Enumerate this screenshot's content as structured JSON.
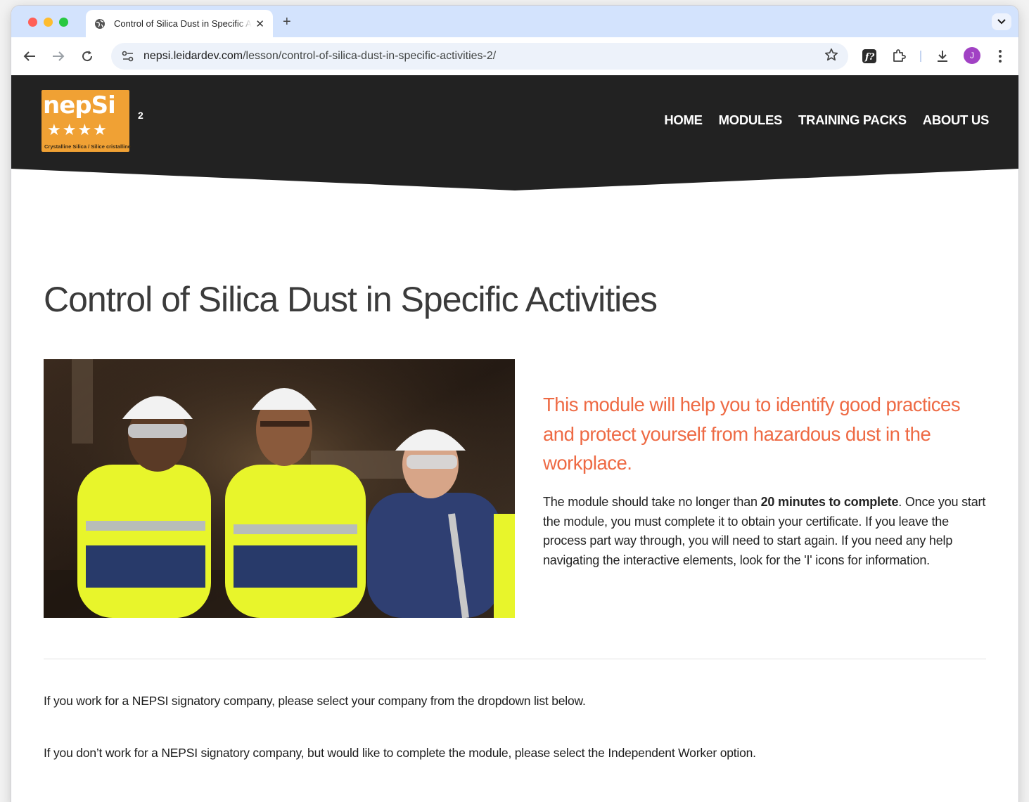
{
  "browser": {
    "tab_title": "Control of Silica Dust in Specific Activities",
    "new_tab": "+",
    "tab_close": "✕",
    "url_domain": "nepsi.leidardev.com",
    "url_path": "/lesson/control-of-silica-dust-in-specific-activities-2/",
    "avatar_letter": "J"
  },
  "site": {
    "logo_text": "nepSi",
    "logo_sup": "2",
    "logo_stars": "★★★★",
    "logo_tagline": "Crystalline Silica / Silice cristalline",
    "nav": [
      "HOME",
      "MODULES",
      "TRAINING PACKS",
      "ABOUT US"
    ]
  },
  "content": {
    "title": "Control of Silica Dust in Specific Activities",
    "lead": "This module will help you to identify good practices and protect yourself from hazardous dust in the workplace.",
    "body_pre": "The module should take no longer than ",
    "body_bold": "20 minutes to complete",
    "body_post": ". Once you start the module, you must complete it to obtain your certificate. If you leave the process part way through, you will need to start again. If you need any help navigating the interactive elements, look for the 'I' icons for information.",
    "info1": "If you work for a NEPSI signatory company, please select your company from the dropdown list below.",
    "info2": "If you don’t work for a NEPSI signatory company, but would like to complete the module, please select the Independent Worker option."
  },
  "colors": {
    "tab_strip": "#d3e3fd",
    "header_bg": "#222222",
    "logo_orange": "#f0a134",
    "lead_orange": "#ee6a44",
    "avatar": "#a142c4"
  }
}
